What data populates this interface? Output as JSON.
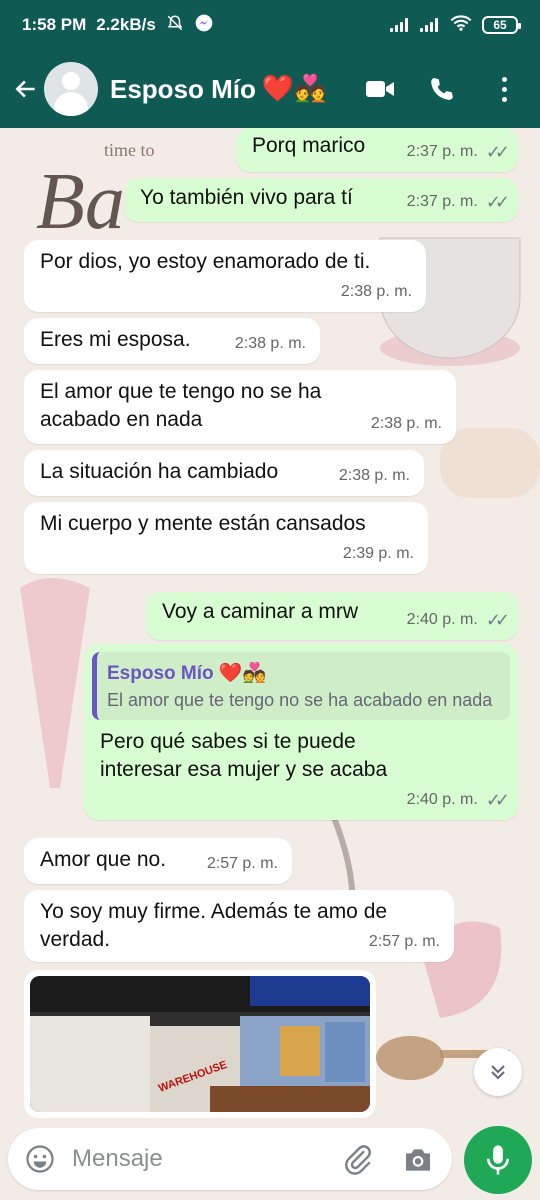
{
  "status_bar": {
    "time": "1:58 PM",
    "speed": "2.2kB/s",
    "battery": "65"
  },
  "header": {
    "contact_name": "Esposo Mío",
    "contact_emoji": "❤️💑"
  },
  "wallpaper": {
    "text_top": "time to",
    "text_big": "Ba"
  },
  "messages": [
    {
      "type": "out",
      "text": "Porq marico",
      "time": "2:37 p. m.",
      "status": "read"
    },
    {
      "type": "out",
      "text": "Yo también vivo para tí",
      "time": "2:37 p. m.",
      "status": "read"
    },
    {
      "type": "in",
      "text": "Por dios, yo estoy enamorado de ti.",
      "time": "2:38 p. m."
    },
    {
      "type": "in",
      "text": "Eres mi esposa.",
      "time": "2:38 p. m."
    },
    {
      "type": "in",
      "text": "El amor que te tengo no se ha acabado en nada",
      "time": "2:38 p. m."
    },
    {
      "type": "in",
      "text": "La situación ha cambiado",
      "time": "2:38 p. m."
    },
    {
      "type": "in",
      "text": "Mi cuerpo y mente están cansados",
      "time": "2:39 p. m."
    },
    {
      "type": "out",
      "text": "Voy a caminar a mrw",
      "time": "2:40 p. m.",
      "status": "read"
    },
    {
      "type": "out",
      "quote_name": "Esposo Mío ❤️💑",
      "quote_text": "El amor que te tengo no se ha acabado en nada",
      "text": "Pero qué sabes si te puede interesar esa mujer y se acaba",
      "time": "2:40 p. m.",
      "status": "read"
    },
    {
      "type": "in",
      "text": "Amor que no.",
      "time": "2:57 p. m."
    },
    {
      "type": "in",
      "text": "Yo soy muy firme. Además te amo de verdad.",
      "time": "2:57 p. m."
    }
  ],
  "photo_message": {
    "label_warehouse": "WAREHOUSE"
  },
  "composer": {
    "placeholder": "Mensaje"
  },
  "colors": {
    "header": "#0f5a52",
    "outgoing": "#d9fdd3",
    "incoming": "#ffffff",
    "accent": "#1fa855",
    "quote_accent": "#6b55c7"
  }
}
